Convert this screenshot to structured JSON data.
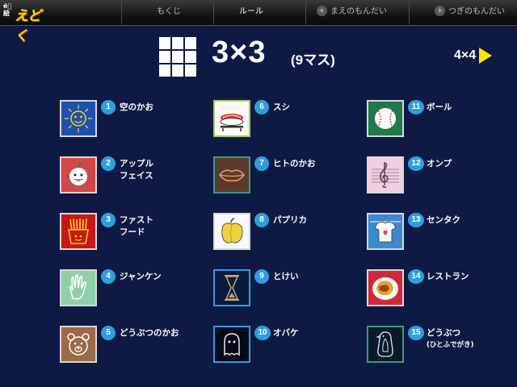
{
  "app": {
    "logo_mini": "ĕ゙ 絵",
    "logo_main": "えどく"
  },
  "nav": {
    "mokuji": "もくじ",
    "rule": "ルール",
    "prev": "まえのもんだい",
    "next": "つぎのもんだい"
  },
  "header": {
    "title": "3×3",
    "subtitle": "(9マス)",
    "next_size": "4×4"
  },
  "colors": {
    "background": "#0f1a44",
    "number_badge": "#2e9fe0",
    "arrow": "#ffe500"
  },
  "items": [
    {
      "num": "1",
      "label": "空のかお",
      "sub": "",
      "icon": "sun-face-icon"
    },
    {
      "num": "2",
      "label": "アップル\nフェイス",
      "sub": "",
      "icon": "apple-face-icon"
    },
    {
      "num": "3",
      "label": "ファスト\nフード",
      "sub": "",
      "icon": "fast-food-icon"
    },
    {
      "num": "4",
      "label": "ジャンケン",
      "sub": "",
      "icon": "hand-icon"
    },
    {
      "num": "5",
      "label": "どうぶつのかお",
      "sub": "",
      "icon": "bear-face-icon"
    },
    {
      "num": "6",
      "label": "スシ",
      "sub": "",
      "icon": "sushi-icon"
    },
    {
      "num": "7",
      "label": "ヒトのかお",
      "sub": "",
      "icon": "lips-icon"
    },
    {
      "num": "8",
      "label": "パプリカ",
      "sub": "",
      "icon": "paprika-icon"
    },
    {
      "num": "9",
      "label": "とけい",
      "sub": "",
      "icon": "hourglass-icon"
    },
    {
      "num": "10",
      "label": "オバケ",
      "sub": "",
      "icon": "ghost-icon"
    },
    {
      "num": "11",
      "label": "ボール",
      "sub": "",
      "icon": "baseball-icon"
    },
    {
      "num": "12",
      "label": "オンプ",
      "sub": "",
      "icon": "treble-clef-icon"
    },
    {
      "num": "13",
      "label": "センタク",
      "sub": "",
      "icon": "laundry-shirt-icon"
    },
    {
      "num": "14",
      "label": "レストラン",
      "sub": "",
      "icon": "curry-plate-icon"
    },
    {
      "num": "15",
      "label": "どうぶつ",
      "sub": "(ひとふでがき)",
      "icon": "penguin-icon"
    }
  ]
}
